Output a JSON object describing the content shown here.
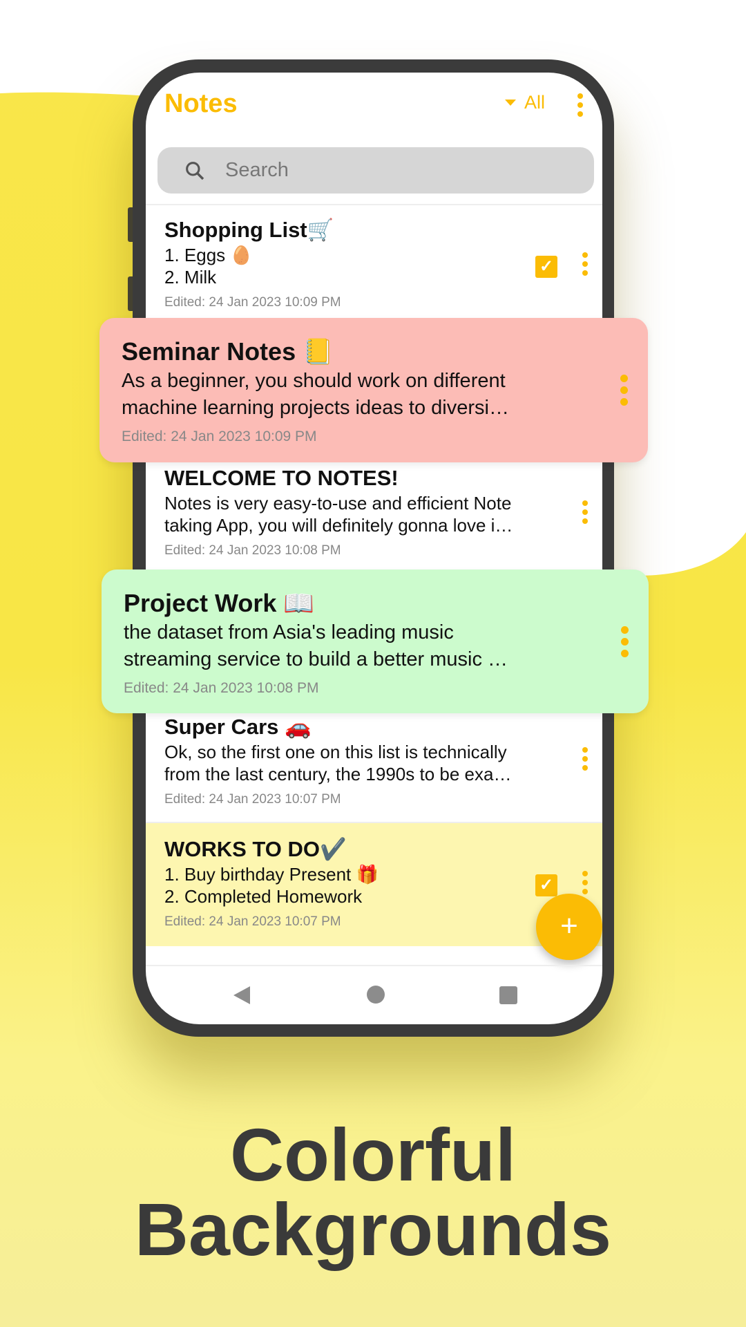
{
  "colors": {
    "accent": "#fbbc05",
    "pink": "#fcbcb6",
    "green": "#ccfbcd",
    "yellow": "#fdf6b0"
  },
  "header": {
    "title": "Notes",
    "filter": "All"
  },
  "search": {
    "placeholder": "Search"
  },
  "notes": [
    {
      "title": "Shopping List🛒",
      "lines": [
        "1. Eggs 🥚",
        "2. Milk"
      ],
      "edited": "Edited: 24 Jan 2023 10:09 PM",
      "checked": true
    },
    {
      "title": "Seminar Notes 📒",
      "lines": [
        "As a beginner, you should work on different",
        "machine learning projects ideas to diversi…"
      ],
      "edited": "Edited: 24 Jan 2023 10:09 PM"
    },
    {
      "title": "WELCOME TO NOTES!",
      "lines": [
        "Notes is very easy-to-use and efficient Note",
        "taking App, you will definitely gonna love i…"
      ],
      "edited": "Edited: 24 Jan 2023 10:08 PM"
    },
    {
      "title": "Project Work 📖",
      "lines": [
        "the dataset from Asia's leading music",
        "streaming service to build a better music …"
      ],
      "edited": "Edited: 24 Jan 2023 10:08 PM"
    },
    {
      "title": "Super Cars 🚗",
      "lines": [
        "Ok, so the first one on this list is technically",
        "from the last century, the 1990s to be exa…"
      ],
      "edited": "Edited: 24 Jan 2023 10:07 PM"
    },
    {
      "title": "WORKS TO DO✔️",
      "lines": [
        "1. Buy birthday Present 🎁",
        "2. Completed Homework"
      ],
      "edited": "Edited: 24 Jan 2023 10:07 PM",
      "checked": true
    }
  ],
  "fab": "+",
  "tagline": [
    "Colorful",
    "Backgrounds"
  ]
}
